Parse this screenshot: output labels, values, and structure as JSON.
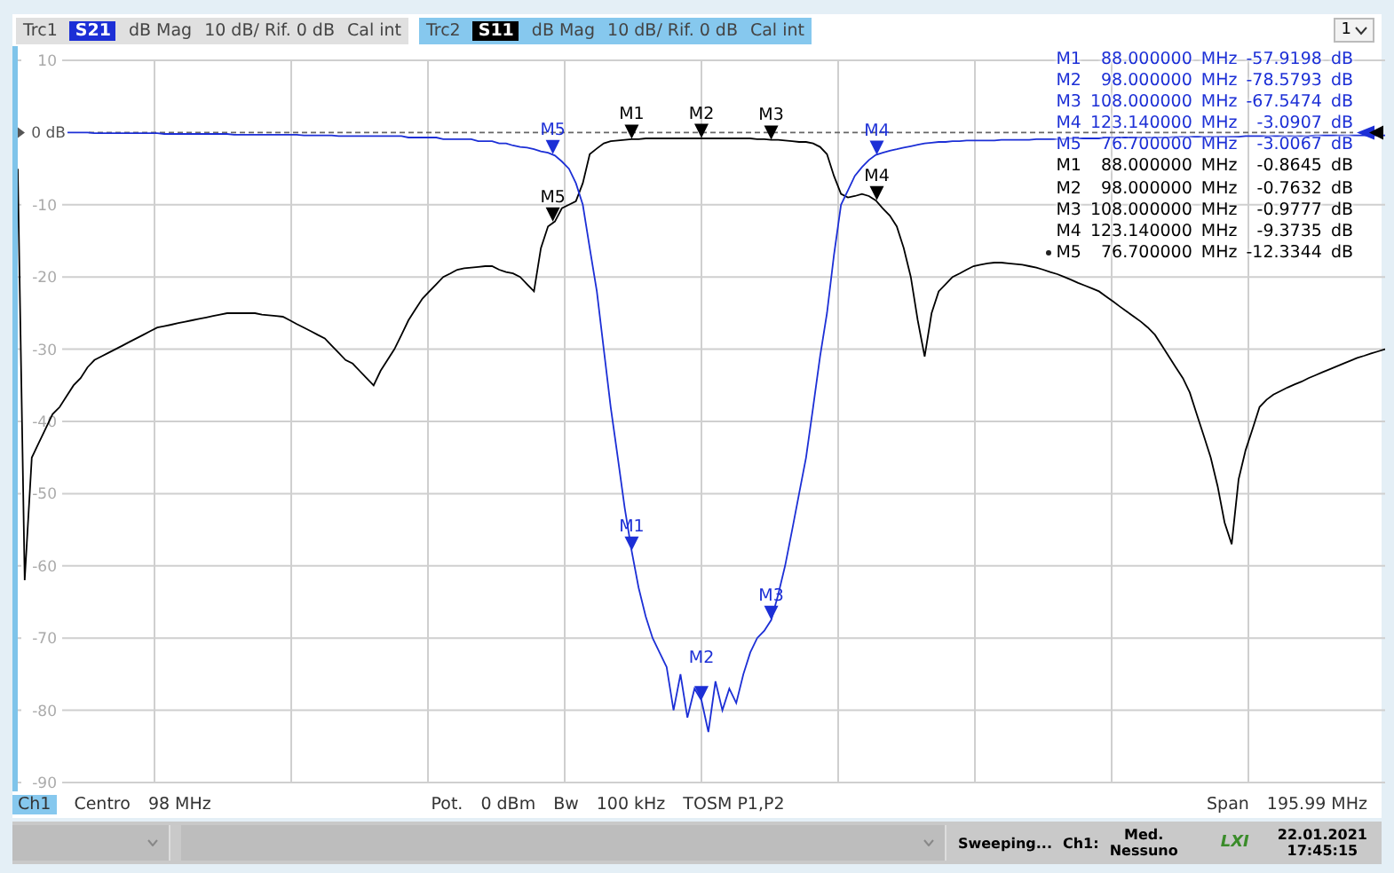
{
  "traces": [
    {
      "name": "Trc1",
      "selected": false,
      "format": "dB Mag",
      "scale": "10 dB/ Rif. 0 dB",
      "cal": "Cal int",
      "marker_rows": [
        {
          "label": "M1",
          "frequency": "88.000000",
          "unit": "MHz",
          "value": "-57.9198",
          "value_unit": "dB",
          "active": false
        },
        {
          "label": "M2",
          "frequency": "98.000000",
          "unit": "MHz",
          "value": "-78.5793",
          "value_unit": "dB",
          "active": false
        },
        {
          "label": "M3",
          "frequency": "108.000000",
          "unit": "MHz",
          "value": "-67.5474",
          "value_unit": "dB",
          "active": false
        },
        {
          "label": "M4",
          "frequency": "123.140000",
          "unit": "MHz",
          "value": "-3.0907",
          "value_unit": "dB",
          "active": false
        },
        {
          "label": "M5",
          "frequency": "76.700000",
          "unit": "MHz",
          "value": "-3.0067",
          "value_unit": "dB",
          "active": false
        }
      ]
    },
    {
      "name": "Trc2",
      "selected": true,
      "format": "dB Mag",
      "scale": "10 dB/ Rif. 0 dB",
      "cal": "Cal int",
      "marker_rows": [
        {
          "label": "M1",
          "frequency": "88.000000",
          "unit": "MHz",
          "value": "-0.8645",
          "value_unit": "dB",
          "active": false
        },
        {
          "label": "M2",
          "frequency": "98.000000",
          "unit": "MHz",
          "value": "-0.7632",
          "value_unit": "dB",
          "active": false
        },
        {
          "label": "M3",
          "frequency": "108.000000",
          "unit": "MHz",
          "value": "-0.9777",
          "value_unit": "dB",
          "active": false
        },
        {
          "label": "M4",
          "frequency": "123.140000",
          "unit": "MHz",
          "value": "-9.3735",
          "value_unit": "dB",
          "active": false
        },
        {
          "label": "M5",
          "frequency": "76.700000",
          "unit": "MHz",
          "value": "-12.3344",
          "value_unit": "dB",
          "active": true
        }
      ]
    }
  ],
  "window_menu": "1",
  "plot_markers": [
    {
      "label": "M1",
      "color": "#1c2fd6"
    },
    {
      "label": "M2",
      "color": "#1c2fd6"
    },
    {
      "label": "M3",
      "color": "#1c2fd6"
    },
    {
      "label": "M4",
      "color": "#1c2fd6"
    },
    {
      "label": "M5",
      "color": "#1c2fd6"
    },
    {
      "label": "M1",
      "color": "#000000"
    },
    {
      "label": "M2",
      "color": "#000000"
    },
    {
      "label": "M3",
      "color": "#000000"
    },
    {
      "label": "M4",
      "color": "#000000"
    },
    {
      "label": "M5",
      "color": "#000000"
    }
  ],
  "chart_data": {
    "type": "line",
    "ylim": [
      -90,
      10
    ],
    "grid": true,
    "ref_lines": [
      {
        "axis": "y",
        "value": 0
      }
    ],
    "yticks": [
      {
        "value": 10,
        "label": "10"
      },
      {
        "value": 0,
        "label": "0 dB"
      },
      {
        "value": -10,
        "label": "-10"
      },
      {
        "value": -20,
        "label": "-20"
      },
      {
        "value": -30,
        "label": "-30"
      },
      {
        "value": -40,
        "label": "-40"
      },
      {
        "value": -50,
        "label": "-50"
      },
      {
        "value": -60,
        "label": "-60"
      },
      {
        "value": -70,
        "label": "-70"
      },
      {
        "value": -80,
        "label": "-80"
      },
      {
        "value": -90,
        "label": "-90"
      }
    ],
    "categories": [
      null,
      null,
      null,
      null,
      null,
      null,
      null,
      null,
      null,
      null,
      null,
      null,
      null,
      null,
      null,
      null,
      null,
      null,
      null,
      null,
      null,
      null,
      null,
      null,
      null,
      null,
      null,
      null,
      null,
      null,
      null,
      null,
      null,
      null,
      null,
      null,
      null,
      null,
      null,
      null,
      null,
      null,
      null,
      null,
      null,
      null,
      null,
      null,
      null,
      null,
      null,
      null,
      null,
      null,
      null,
      null,
      null,
      null,
      null,
      null,
      null,
      null,
      null,
      null,
      null,
      null,
      null,
      null,
      null,
      null,
      null,
      null,
      null,
      null,
      null,
      null,
      null,
      null,
      null,
      null,
      null,
      null,
      null,
      null,
      null,
      null,
      null,
      null,
      null,
      null,
      null,
      null,
      null,
      null,
      null,
      null,
      null,
      null,
      null,
      null,
      null,
      null,
      null,
      null,
      null,
      null,
      null,
      null,
      null,
      null,
      null,
      null,
      null,
      null,
      null,
      null,
      null,
      null,
      null,
      null,
      null,
      null,
      null,
      null,
      null,
      null,
      null,
      null,
      null,
      null,
      null,
      null,
      null,
      null,
      null,
      null,
      null,
      null,
      null,
      null,
      null,
      null,
      null,
      null,
      null,
      null,
      null,
      null,
      null,
      null,
      null,
      null,
      null,
      null,
      null,
      null,
      null,
      null,
      null,
      null,
      null,
      null,
      null,
      null,
      null,
      null,
      null,
      null,
      null,
      null,
      null,
      null,
      null,
      null,
      null,
      null,
      null,
      null,
      null,
      null,
      null,
      null,
      null,
      null,
      null,
      null,
      null,
      null,
      null,
      null,
      null,
      null,
      null,
      null,
      null,
      null,
      null
    ],
    "series": [
      {
        "name": "S21",
        "color": "#1c2fd6",
        "values": [
          null,
          null,
          null,
          null,
          null,
          null,
          null,
          0,
          0,
          0,
          0,
          -0.1,
          -0.1,
          -0.1,
          -0.1,
          -0.1,
          -0.1,
          -0.1,
          -0.1,
          -0.1,
          -0.1,
          -0.2,
          -0.2,
          -0.2,
          -0.2,
          -0.2,
          -0.2,
          -0.2,
          -0.2,
          -0.2,
          -0.2,
          -0.3,
          -0.3,
          -0.3,
          -0.3,
          -0.3,
          -0.3,
          -0.3,
          -0.3,
          -0.3,
          -0.3,
          -0.4,
          -0.4,
          -0.4,
          -0.4,
          -0.4,
          -0.5,
          -0.5,
          -0.5,
          -0.5,
          -0.5,
          -0.5,
          -0.5,
          -0.5,
          -0.5,
          -0.5,
          -0.7,
          -0.7,
          -0.7,
          -0.7,
          -0.7,
          -0.9,
          -0.9,
          -0.9,
          -0.9,
          -0.9,
          -1.2,
          -1.2,
          -1.2,
          -1.5,
          -1.5,
          -1.8,
          -2,
          -2.1,
          -2.3,
          -2.6,
          -2.8,
          -3.2,
          -4,
          -5,
          -7,
          -10,
          -16,
          -22,
          -30,
          -38,
          -45,
          -52,
          -57.9,
          -63,
          -67,
          -70,
          -72,
          -74,
          -80,
          -75,
          -81,
          -77,
          -78.6,
          -83,
          -76,
          -80,
          -77,
          -79,
          -75,
          -72,
          -70,
          -69,
          -67.5,
          -64,
          -60,
          -55,
          -50,
          -45,
          -38,
          -31,
          -25,
          -17,
          -10,
          -8,
          -6,
          -4.8,
          -3.8,
          -3.1,
          -2.8,
          -2.5,
          -2.3,
          -2.1,
          -1.9,
          -1.7,
          -1.5,
          -1.4,
          -1.3,
          -1.3,
          -1.2,
          -1.2,
          -1.1,
          -1.1,
          -1.1,
          -1.1,
          -1.1,
          -1,
          -1,
          -1,
          -1,
          -1,
          -0.9,
          -0.9,
          -0.9,
          -0.9,
          -0.9,
          -0.8,
          -0.8,
          -0.8,
          -0.8,
          -0.8,
          -0.7,
          -0.7,
          -0.7,
          -0.7,
          -0.7,
          -0.7,
          -0.7,
          -0.7,
          -0.7,
          -0.7,
          -0.6,
          -0.6,
          -0.6,
          -0.6,
          -0.6,
          -0.6,
          -0.6,
          -0.6,
          -0.6,
          -0.6,
          -0.5,
          -0.5,
          -0.5,
          -0.5,
          -0.5,
          -0.5,
          -0.5,
          -0.5,
          -0.5,
          -0.5,
          -0.4,
          -0.4,
          -0.4,
          -0.4,
          -0.4,
          -0.4,
          -0.4,
          -0.4,
          -0.4,
          -0.4,
          -0.4
        ]
      },
      {
        "name": "S11",
        "color": "#000000",
        "values": [
          -5,
          -62,
          -45,
          -43,
          -41,
          -39,
          -38,
          -36.5,
          -35,
          -34,
          -32.5,
          -31.5,
          -31,
          -30.5,
          -30,
          -29.5,
          -29,
          -28.5,
          -28,
          -27.5,
          -27,
          -26.8,
          -26.6,
          -26.4,
          -26.2,
          -26,
          -25.8,
          -25.6,
          -25.4,
          -25.2,
          -25,
          -25,
          -25,
          -25,
          -25,
          -25.2,
          -25.3,
          -25.4,
          -25.5,
          -26,
          -26.5,
          -27,
          -27.5,
          -28,
          -28.5,
          -29.5,
          -30.5,
          -31.5,
          -32,
          -33,
          -34,
          -35,
          -33,
          -31.5,
          -30,
          -28,
          -26,
          -24.5,
          -23,
          -22,
          -21,
          -20,
          -19.5,
          -19,
          -18.8,
          -18.7,
          -18.6,
          -18.5,
          -18.5,
          -19,
          -19.3,
          -19.5,
          -20,
          -21,
          -22,
          -16,
          -13,
          -12.3,
          -10.5,
          -10,
          -9.5,
          -7,
          -3,
          -2.2,
          -1.5,
          -1.2,
          -1.1,
          -1,
          -0.9,
          -0.9,
          -0.8,
          -0.8,
          -0.8,
          -0.8,
          -0.8,
          -0.8,
          -0.8,
          -0.8,
          -0.8,
          -0.8,
          -0.8,
          -0.8,
          -0.8,
          -0.8,
          -0.8,
          -0.8,
          -0.9,
          -0.9,
          -1,
          -1,
          -1.1,
          -1.2,
          -1.3,
          -1.3,
          -1.5,
          -2,
          -3,
          -6,
          -8.5,
          -9,
          -8.8,
          -8.5,
          -8.8,
          -9.4,
          -10.5,
          -11.5,
          -13,
          -16,
          -20,
          -26,
          -31,
          -25,
          -22,
          -21,
          -20,
          -19.5,
          -19,
          -18.5,
          -18.3,
          -18.1,
          -18,
          -18,
          -18.1,
          -18.2,
          -18.3,
          -18.5,
          -18.7,
          -19,
          -19.3,
          -19.6,
          -20,
          -20.4,
          -20.8,
          -21.2,
          -21.6,
          -22,
          -22.7,
          -23.4,
          -24.1,
          -24.8,
          -25.5,
          -26.2,
          -27,
          -28,
          -29.5,
          -31,
          -32.5,
          -34,
          -36,
          -39,
          -42,
          -45,
          -49,
          -54,
          -57,
          -48,
          -44,
          -41,
          -38,
          -37,
          -36.3,
          -35.8,
          -35.3,
          -34.9,
          -34.5,
          -34,
          -33.6,
          -33.2,
          -32.8,
          -32.4,
          -32,
          -31.6,
          -31.2,
          -30.9,
          -30.6,
          -30.3,
          -30
        ]
      }
    ]
  },
  "channel_bar": {
    "channel": "Ch1",
    "center_label": "Centro",
    "center_value": "98 MHz",
    "power_label": "Pot.",
    "power_value": "0 dBm",
    "bw_label": "Bw",
    "bw_value": "100 kHz",
    "calibration": "TOSM P1,P2",
    "span_label": "Span",
    "span_value": "195.99 MHz"
  },
  "status_bar": {
    "state": "Sweeping...",
    "channel": "Ch1:",
    "average_label": "Med.",
    "average_value": "Nessuno",
    "badge": "LXI",
    "date": "22.01.2021",
    "time": "17:45:15"
  }
}
